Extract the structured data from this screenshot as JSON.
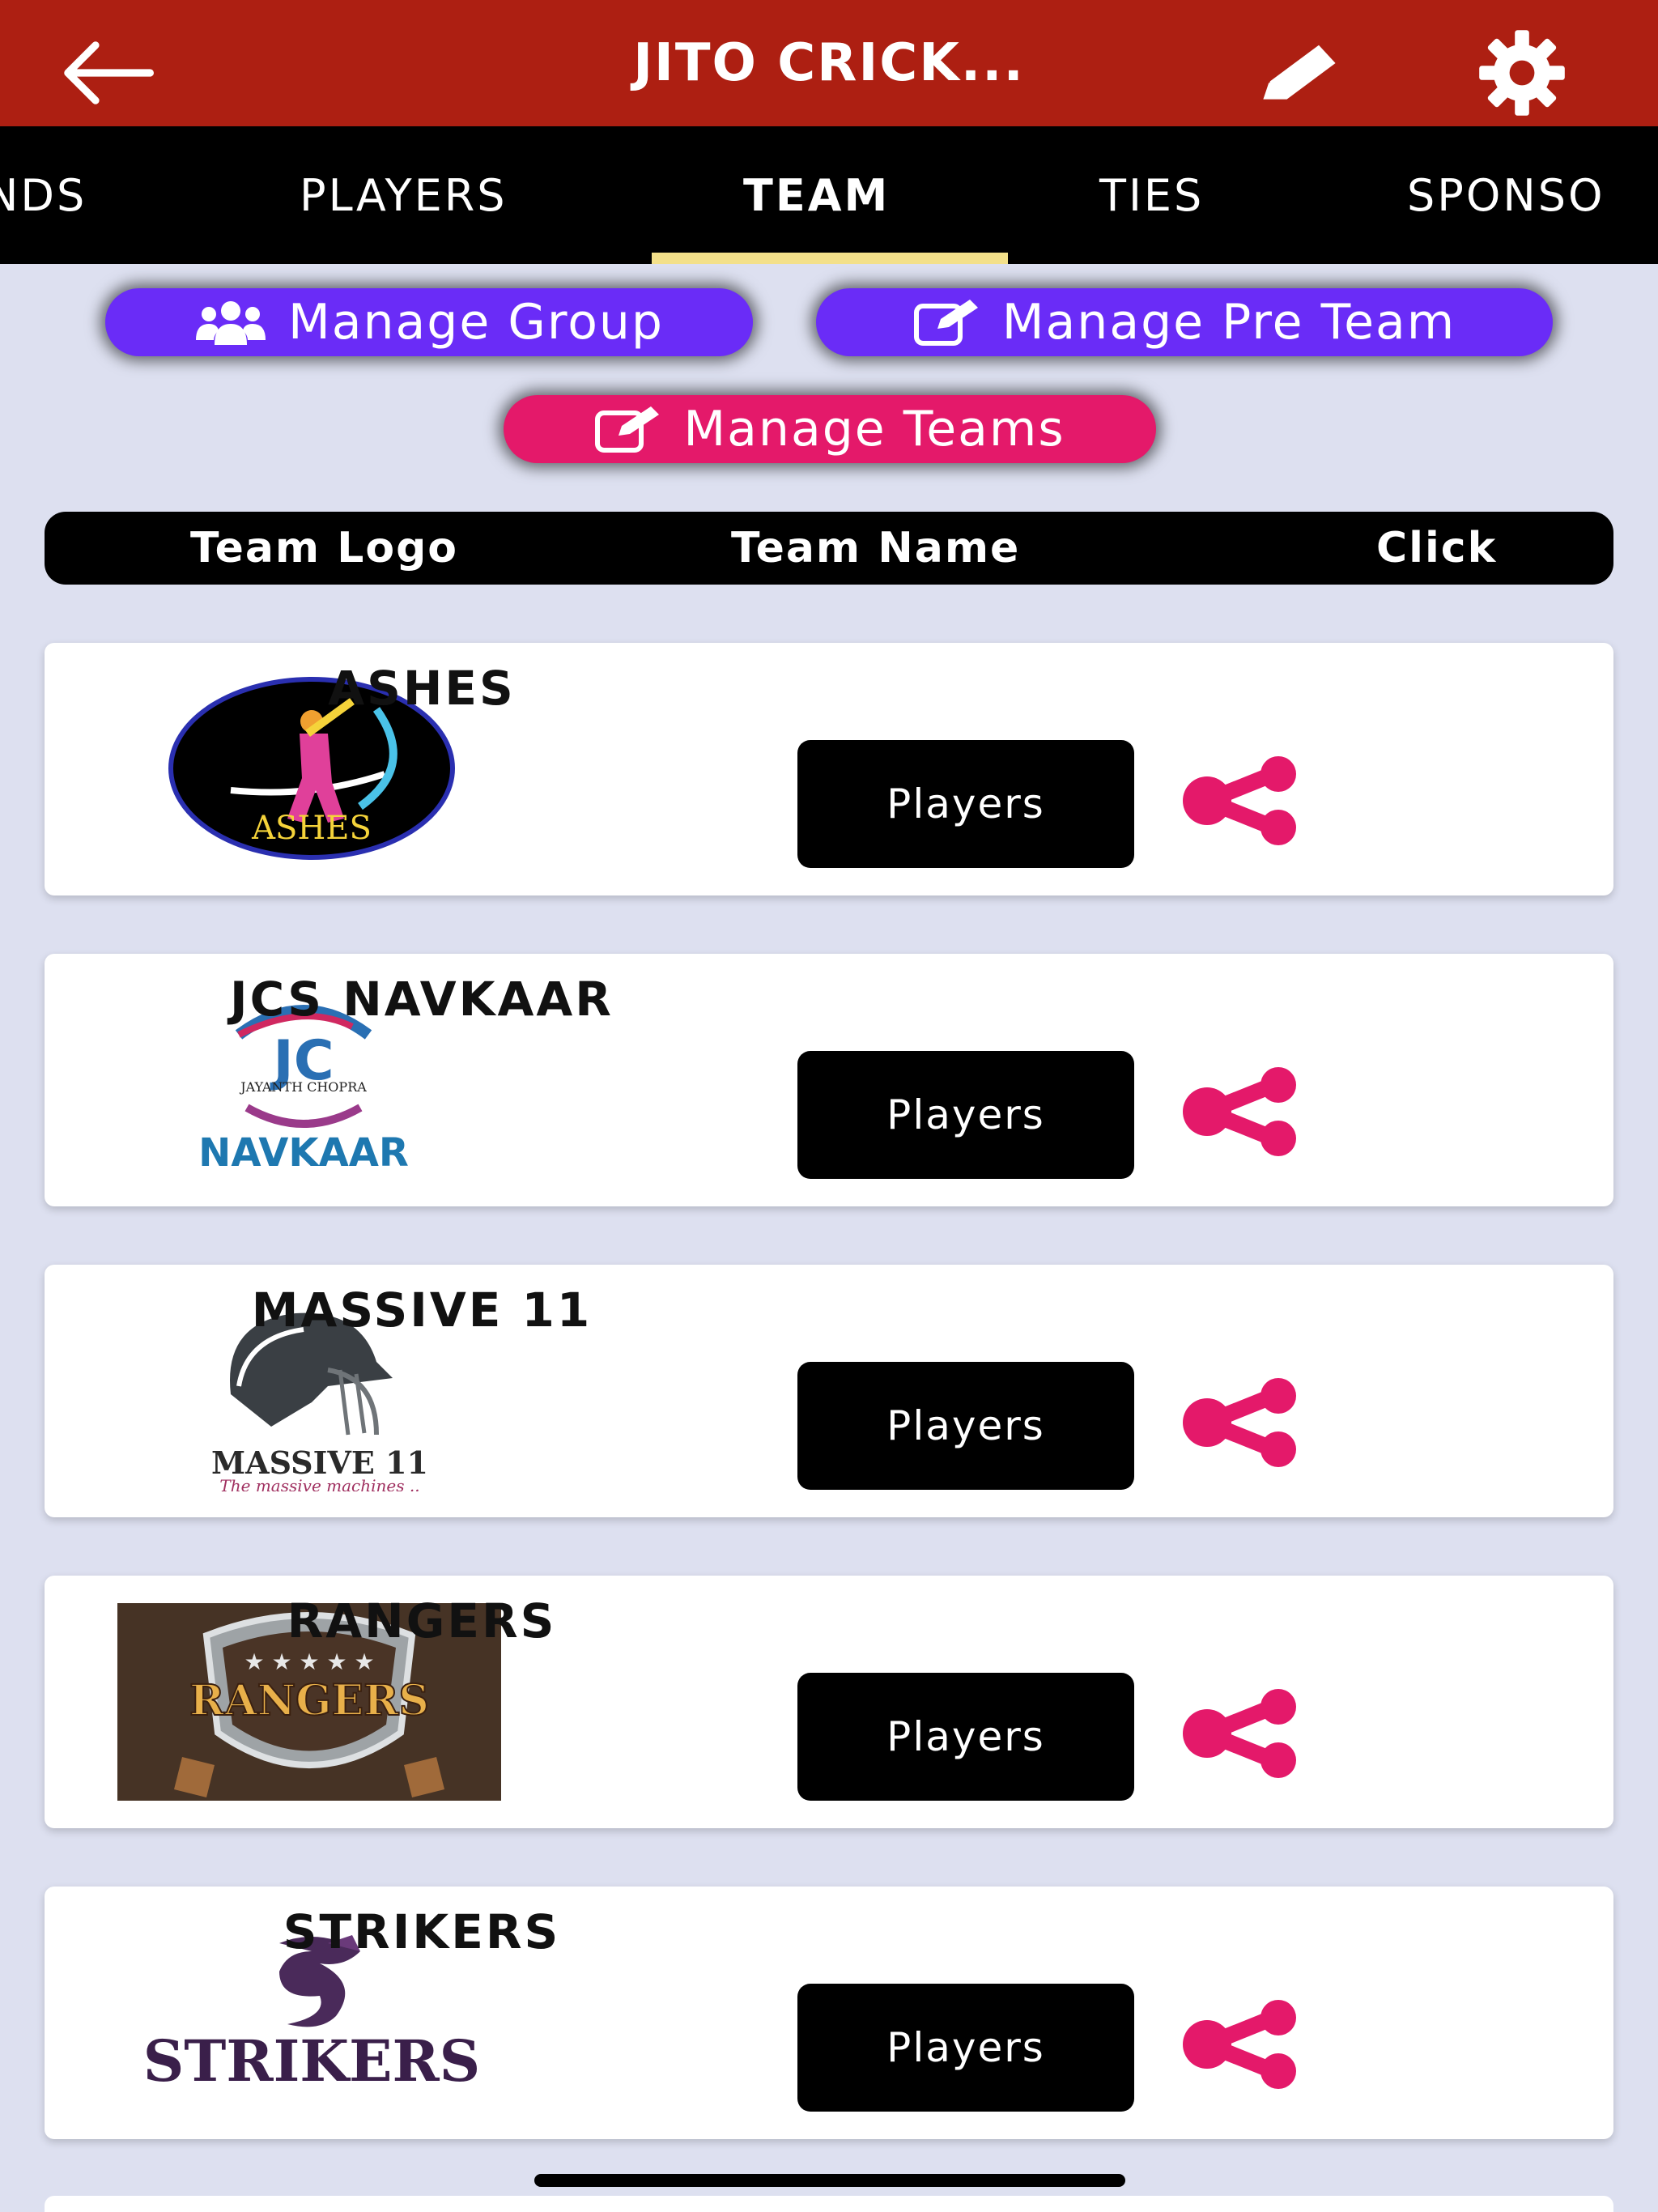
{
  "header": {
    "title": "JITO CRICK..."
  },
  "tabs": [
    {
      "label": "NDS",
      "active": false
    },
    {
      "label": "PLAYERS",
      "active": false
    },
    {
      "label": "TEAM",
      "active": true
    },
    {
      "label": "TIES",
      "active": false
    },
    {
      "label": "SPONSO",
      "active": false
    }
  ],
  "actions": {
    "manage_group": "Manage Group",
    "manage_pre_team": "Manage Pre Team",
    "manage_teams": "Manage Teams"
  },
  "table": {
    "col_logo": "Team Logo",
    "col_name": "Team Name",
    "col_click": "Click"
  },
  "teams": [
    {
      "name": "ASHES",
      "players_label": "Players",
      "logo_text": "ASHES"
    },
    {
      "name": "JCS NAVKAAR",
      "players_label": "Players",
      "logo_text": "NAVKAAR",
      "logo_sub": "JAYANTH CHOPRA"
    },
    {
      "name": "MASSIVE 11",
      "players_label": "Players",
      "logo_text": "MASSIVE 11",
      "logo_sub": "The massive machines .."
    },
    {
      "name": "RANGERS",
      "players_label": "Players",
      "logo_text": "RANGERS"
    },
    {
      "name": "STRIKERS",
      "players_label": "Players",
      "logo_text": "STRIKERS"
    }
  ],
  "colors": {
    "header": "#ad1f12",
    "purple_pill": "#6a2cf7",
    "pink_pill": "#e4196a",
    "share_icon": "#e4196a",
    "tab_indicator": "#f3e08a"
  }
}
